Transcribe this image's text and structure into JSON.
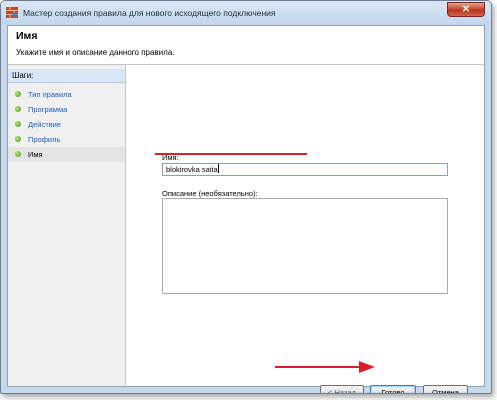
{
  "window": {
    "title": "Мастер создания правила для нового исходящего подключения",
    "close_glyph": "✕"
  },
  "header": {
    "title": "Имя",
    "subtitle": "Укажите имя и описание данного правила."
  },
  "sidebar": {
    "heading": "Шаги:",
    "items": [
      {
        "label": "Тип правила",
        "current": false
      },
      {
        "label": "Программа",
        "current": false
      },
      {
        "label": "Действие",
        "current": false
      },
      {
        "label": "Профиль",
        "current": false
      },
      {
        "label": "Имя",
        "current": true
      }
    ]
  },
  "form": {
    "name_label": "Имя:",
    "name_value": "blokirovka saita",
    "description_label": "Описание (необязательно):",
    "description_value": ""
  },
  "buttons": {
    "back": "< Назад",
    "finish": "Готово",
    "cancel": "Отмена"
  },
  "colors": {
    "annotation": "#d9202a",
    "link": "#1f5fbf",
    "step_dot": "#3f9a14"
  },
  "icons": {
    "title": "firewall-icon",
    "close": "close-icon",
    "step": "step-dot-icon"
  }
}
